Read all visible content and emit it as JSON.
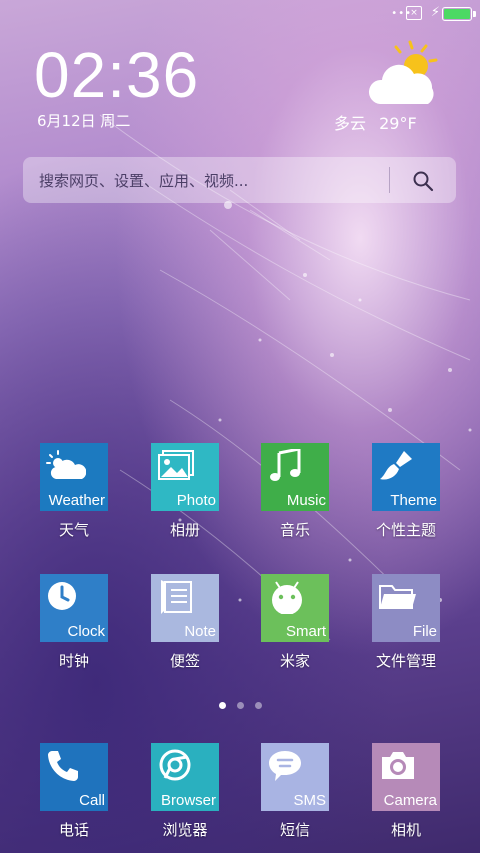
{
  "status_bar": {
    "signal_dots": "•••",
    "sim_icon": "sim-off-icon",
    "charging_icon": "bolt-icon",
    "battery_level": 1.0,
    "battery_color": "#4cd964"
  },
  "clock": {
    "time": "02:36",
    "date": "6月12日 周二"
  },
  "weather": {
    "icon": "partly-cloudy-icon",
    "condition": "多云",
    "temperature": "29°F"
  },
  "search": {
    "placeholder": "搜索网页、设置、应用、视频..."
  },
  "apps_row1": [
    {
      "name": "天气",
      "tile_label": "Weather",
      "icon": "weather-icon",
      "color": "#1c7ac0"
    },
    {
      "name": "相册",
      "tile_label": "Photo",
      "icon": "photo-icon",
      "color": "#2fb8c4"
    },
    {
      "name": "音乐",
      "tile_label": "Music",
      "icon": "music-note-icon",
      "color": "#3fae49"
    },
    {
      "name": "个性主题",
      "tile_label": "Theme",
      "icon": "paint-brush-icon",
      "color": "#1f7ac4"
    }
  ],
  "apps_row2": [
    {
      "name": "时钟",
      "tile_label": "Clock",
      "icon": "clock-icon",
      "color": "#2f7fc8"
    },
    {
      "name": "便签",
      "tile_label": "Note",
      "icon": "note-icon",
      "color": "#aab8df"
    },
    {
      "name": "米家",
      "tile_label": "Smart",
      "icon": "android-robot-icon",
      "color": "#6cc05b"
    },
    {
      "name": "文件管理",
      "tile_label": "File",
      "icon": "folder-icon",
      "color": "#8d8cc4"
    }
  ],
  "pager": {
    "page_count": 3,
    "current_page": 1
  },
  "dock": [
    {
      "name": "电话",
      "tile_label": "Call",
      "icon": "phone-icon",
      "color": "#1f73bd"
    },
    {
      "name": "浏览器",
      "tile_label": "Browser",
      "icon": "browser-icon",
      "color": "#2ab0bf"
    },
    {
      "name": "短信",
      "tile_label": "SMS",
      "icon": "sms-icon",
      "color": "#a9b4e3"
    },
    {
      "name": "相机",
      "tile_label": "Camera",
      "icon": "camera-icon",
      "color": "#b68ab8"
    }
  ]
}
